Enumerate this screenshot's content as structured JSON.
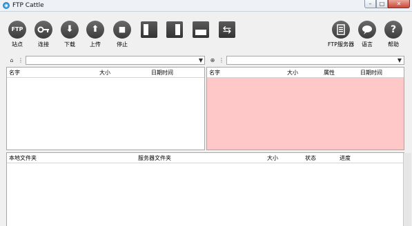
{
  "window": {
    "title": "FTP Cattle",
    "app_icon": "cattle-icon",
    "controls": {
      "minimize": "–",
      "maximize": "□",
      "close": "✕"
    }
  },
  "toolbar": {
    "site": {
      "icon_text": "FTP",
      "label": "站点"
    },
    "connect": {
      "icon": "key-icon",
      "label": "连接"
    },
    "download": {
      "icon": "download-icon",
      "glyph": "⬇",
      "label": "下载"
    },
    "upload": {
      "icon": "upload-icon",
      "glyph": "⬆",
      "label": "上传"
    },
    "stop": {
      "icon": "stop-icon",
      "glyph": "■",
      "label": "停止"
    },
    "layout_buttons": [
      "layout-left-icon",
      "layout-right-icon",
      "layout-bottom-icon",
      "swap-panels-icon"
    ],
    "swap_glyph": "⇆",
    "ftp_server": {
      "icon": "server-icon",
      "label": "FTP服务器"
    },
    "language": {
      "icon": "speech-bubble-icon",
      "glyph": "…",
      "label": "语言"
    },
    "help": {
      "icon": "help-icon",
      "glyph": "?",
      "label": "帮助"
    }
  },
  "path_bars": {
    "local": {
      "value": "",
      "icons": [
        "computer-icon",
        "tree-icon"
      ]
    },
    "remote": {
      "value": "",
      "icons": [
        "globe-icon",
        "tree-icon"
      ]
    },
    "dropdown_glyph": "▼",
    "computer_glyph": "⌂",
    "tree_glyph": "⋮",
    "globe_glyph": "⊕"
  },
  "local_panel": {
    "columns": [
      "名字",
      "大小",
      "日期时间"
    ]
  },
  "remote_panel": {
    "columns": [
      "名字",
      "大小",
      "属性",
      "日期时间"
    ],
    "background": "#ffc8c8"
  },
  "queue_panel": {
    "columns": [
      "本地文件夹",
      "服务器文件夹",
      "大小",
      "状态",
      "进度"
    ]
  }
}
